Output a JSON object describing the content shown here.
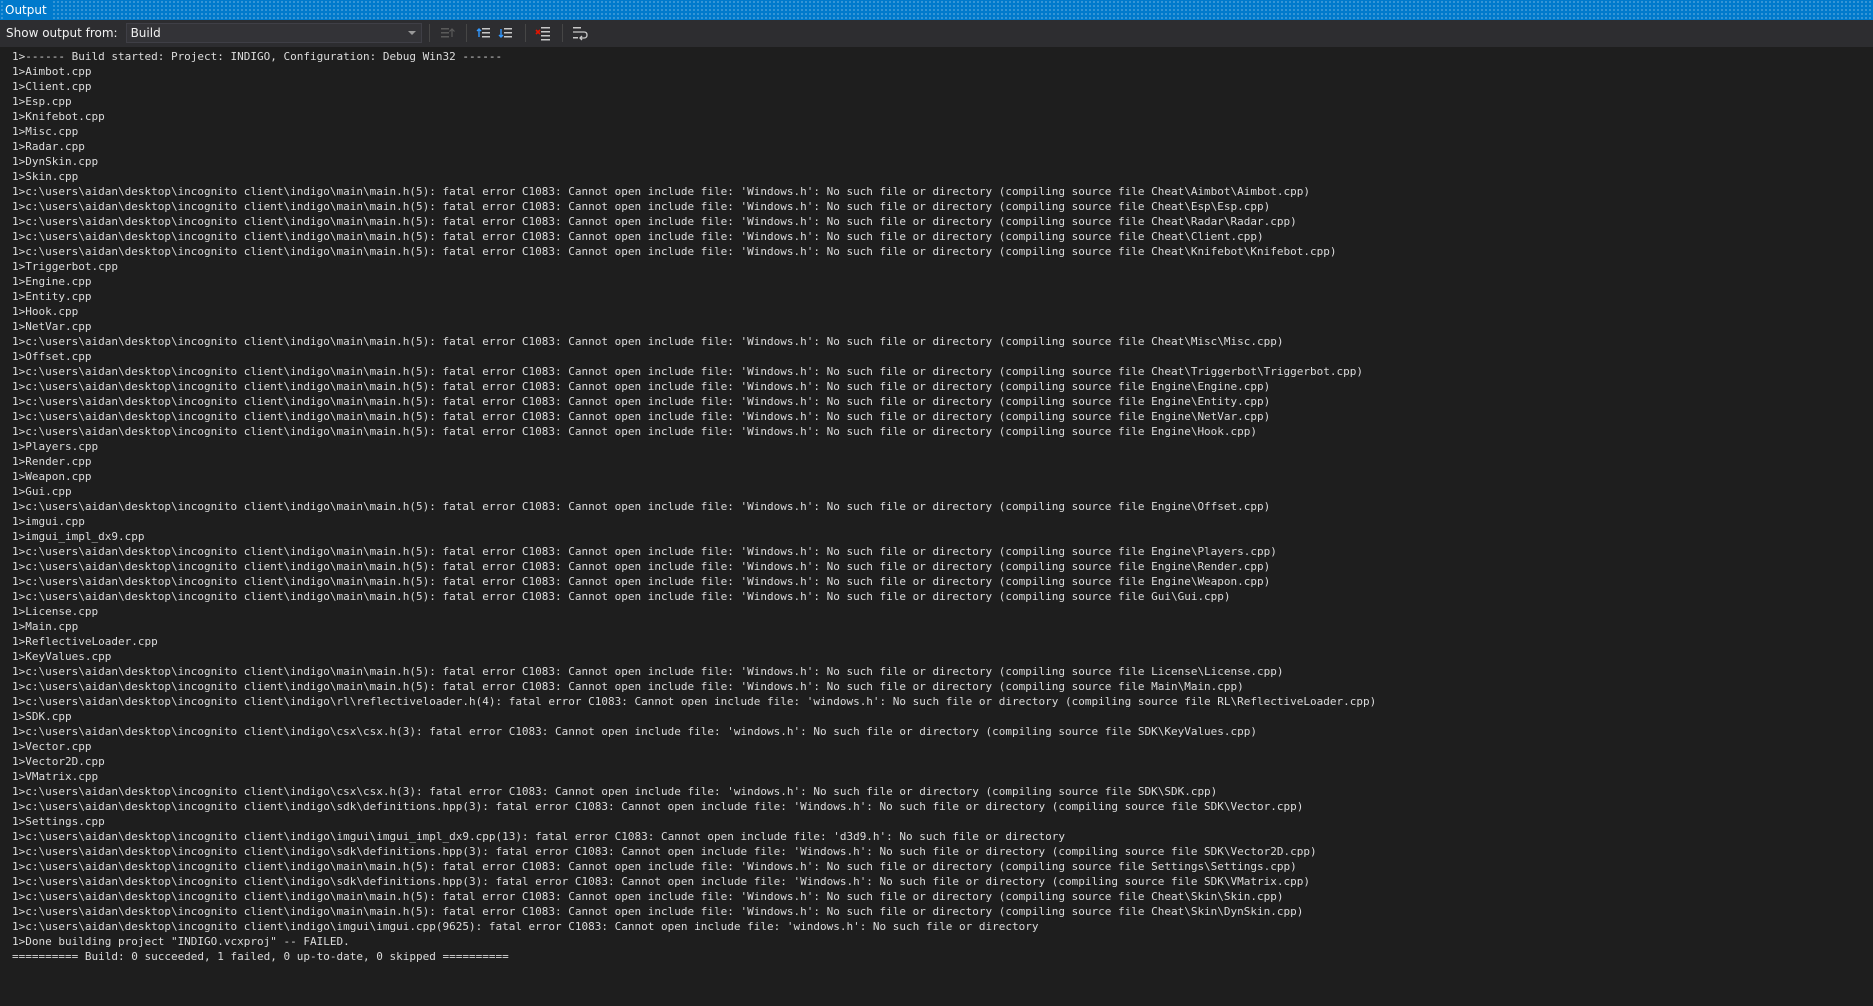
{
  "window": {
    "title": "Output"
  },
  "toolbar": {
    "show_output_label": "Show output from:",
    "source_selected": "Build",
    "buttons": [
      {
        "name": "go-to-previous-message-icon",
        "interactable": true
      },
      {
        "name": "find-previous-message-icon",
        "interactable": true
      },
      {
        "name": "find-next-message-icon",
        "interactable": true
      },
      {
        "name": "clear-all-icon",
        "interactable": true
      },
      {
        "name": "toggle-word-wrap-icon",
        "interactable": true
      }
    ]
  },
  "colors": {
    "accent": "#007acc",
    "background": "#1e1e1e",
    "toolbar": "#2d2d30",
    "text": "#dcdcdc"
  },
  "output_lines": [
    "1>------ Build started: Project: INDIGO, Configuration: Debug Win32 ------",
    "1>Aimbot.cpp",
    "1>Client.cpp",
    "1>Esp.cpp",
    "1>Knifebot.cpp",
    "1>Misc.cpp",
    "1>Radar.cpp",
    "1>DynSkin.cpp",
    "1>Skin.cpp",
    "1>c:\\users\\aidan\\desktop\\incognito client\\indigo\\main\\main.h(5): fatal error C1083: Cannot open include file: 'Windows.h': No such file or directory (compiling source file Cheat\\Aimbot\\Aimbot.cpp)",
    "1>c:\\users\\aidan\\desktop\\incognito client\\indigo\\main\\main.h(5): fatal error C1083: Cannot open include file: 'Windows.h': No such file or directory (compiling source file Cheat\\Esp\\Esp.cpp)",
    "1>c:\\users\\aidan\\desktop\\incognito client\\indigo\\main\\main.h(5): fatal error C1083: Cannot open include file: 'Windows.h': No such file or directory (compiling source file Cheat\\Radar\\Radar.cpp)",
    "1>c:\\users\\aidan\\desktop\\incognito client\\indigo\\main\\main.h(5): fatal error C1083: Cannot open include file: 'Windows.h': No such file or directory (compiling source file Cheat\\Client.cpp)",
    "1>c:\\users\\aidan\\desktop\\incognito client\\indigo\\main\\main.h(5): fatal error C1083: Cannot open include file: 'Windows.h': No such file or directory (compiling source file Cheat\\Knifebot\\Knifebot.cpp)",
    "1>Triggerbot.cpp",
    "1>Engine.cpp",
    "1>Entity.cpp",
    "1>Hook.cpp",
    "1>NetVar.cpp",
    "1>c:\\users\\aidan\\desktop\\incognito client\\indigo\\main\\main.h(5): fatal error C1083: Cannot open include file: 'Windows.h': No such file or directory (compiling source file Cheat\\Misc\\Misc.cpp)",
    "1>Offset.cpp",
    "1>c:\\users\\aidan\\desktop\\incognito client\\indigo\\main\\main.h(5): fatal error C1083: Cannot open include file: 'Windows.h': No such file or directory (compiling source file Cheat\\Triggerbot\\Triggerbot.cpp)",
    "1>c:\\users\\aidan\\desktop\\incognito client\\indigo\\main\\main.h(5): fatal error C1083: Cannot open include file: 'Windows.h': No such file or directory (compiling source file Engine\\Engine.cpp)",
    "1>c:\\users\\aidan\\desktop\\incognito client\\indigo\\main\\main.h(5): fatal error C1083: Cannot open include file: 'Windows.h': No such file or directory (compiling source file Engine\\Entity.cpp)",
    "1>c:\\users\\aidan\\desktop\\incognito client\\indigo\\main\\main.h(5): fatal error C1083: Cannot open include file: 'Windows.h': No such file or directory (compiling source file Engine\\NetVar.cpp)",
    "1>c:\\users\\aidan\\desktop\\incognito client\\indigo\\main\\main.h(5): fatal error C1083: Cannot open include file: 'Windows.h': No such file or directory (compiling source file Engine\\Hook.cpp)",
    "1>Players.cpp",
    "1>Render.cpp",
    "1>Weapon.cpp",
    "1>Gui.cpp",
    "1>c:\\users\\aidan\\desktop\\incognito client\\indigo\\main\\main.h(5): fatal error C1083: Cannot open include file: 'Windows.h': No such file or directory (compiling source file Engine\\Offset.cpp)",
    "1>imgui.cpp",
    "1>imgui_impl_dx9.cpp",
    "1>c:\\users\\aidan\\desktop\\incognito client\\indigo\\main\\main.h(5): fatal error C1083: Cannot open include file: 'Windows.h': No such file or directory (compiling source file Engine\\Players.cpp)",
    "1>c:\\users\\aidan\\desktop\\incognito client\\indigo\\main\\main.h(5): fatal error C1083: Cannot open include file: 'Windows.h': No such file or directory (compiling source file Engine\\Render.cpp)",
    "1>c:\\users\\aidan\\desktop\\incognito client\\indigo\\main\\main.h(5): fatal error C1083: Cannot open include file: 'Windows.h': No such file or directory (compiling source file Engine\\Weapon.cpp)",
    "1>c:\\users\\aidan\\desktop\\incognito client\\indigo\\main\\main.h(5): fatal error C1083: Cannot open include file: 'Windows.h': No such file or directory (compiling source file Gui\\Gui.cpp)",
    "1>License.cpp",
    "1>Main.cpp",
    "1>ReflectiveLoader.cpp",
    "1>KeyValues.cpp",
    "1>c:\\users\\aidan\\desktop\\incognito client\\indigo\\main\\main.h(5): fatal error C1083: Cannot open include file: 'Windows.h': No such file or directory (compiling source file License\\License.cpp)",
    "1>c:\\users\\aidan\\desktop\\incognito client\\indigo\\main\\main.h(5): fatal error C1083: Cannot open include file: 'Windows.h': No such file or directory (compiling source file Main\\Main.cpp)",
    "1>c:\\users\\aidan\\desktop\\incognito client\\indigo\\rl\\reflectiveloader.h(4): fatal error C1083: Cannot open include file: 'windows.h': No such file or directory (compiling source file RL\\ReflectiveLoader.cpp)",
    "1>SDK.cpp",
    "1>c:\\users\\aidan\\desktop\\incognito client\\indigo\\csx\\csx.h(3): fatal error C1083: Cannot open include file: 'windows.h': No such file or directory (compiling source file SDK\\KeyValues.cpp)",
    "1>Vector.cpp",
    "1>Vector2D.cpp",
    "1>VMatrix.cpp",
    "1>c:\\users\\aidan\\desktop\\incognito client\\indigo\\csx\\csx.h(3): fatal error C1083: Cannot open include file: 'windows.h': No such file or directory (compiling source file SDK\\SDK.cpp)",
    "1>c:\\users\\aidan\\desktop\\incognito client\\indigo\\sdk\\definitions.hpp(3): fatal error C1083: Cannot open include file: 'Windows.h': No such file or directory (compiling source file SDK\\Vector.cpp)",
    "1>Settings.cpp",
    "1>c:\\users\\aidan\\desktop\\incognito client\\indigo\\imgui\\imgui_impl_dx9.cpp(13): fatal error C1083: Cannot open include file: 'd3d9.h': No such file or directory",
    "1>c:\\users\\aidan\\desktop\\incognito client\\indigo\\sdk\\definitions.hpp(3): fatal error C1083: Cannot open include file: 'Windows.h': No such file or directory (compiling source file SDK\\Vector2D.cpp)",
    "1>c:\\users\\aidan\\desktop\\incognito client\\indigo\\main\\main.h(5): fatal error C1083: Cannot open include file: 'Windows.h': No such file or directory (compiling source file Settings\\Settings.cpp)",
    "1>c:\\users\\aidan\\desktop\\incognito client\\indigo\\sdk\\definitions.hpp(3): fatal error C1083: Cannot open include file: 'Windows.h': No such file or directory (compiling source file SDK\\VMatrix.cpp)",
    "1>c:\\users\\aidan\\desktop\\incognito client\\indigo\\main\\main.h(5): fatal error C1083: Cannot open include file: 'Windows.h': No such file or directory (compiling source file Cheat\\Skin\\Skin.cpp)",
    "1>c:\\users\\aidan\\desktop\\incognito client\\indigo\\main\\main.h(5): fatal error C1083: Cannot open include file: 'Windows.h': No such file or directory (compiling source file Cheat\\Skin\\DynSkin.cpp)",
    "1>c:\\users\\aidan\\desktop\\incognito client\\indigo\\imgui\\imgui.cpp(9625): fatal error C1083: Cannot open include file: 'windows.h': No such file or directory",
    "1>Done building project \"INDIGO.vcxproj\" -- FAILED.",
    "========== Build: 0 succeeded, 1 failed, 0 up-to-date, 0 skipped =========="
  ]
}
